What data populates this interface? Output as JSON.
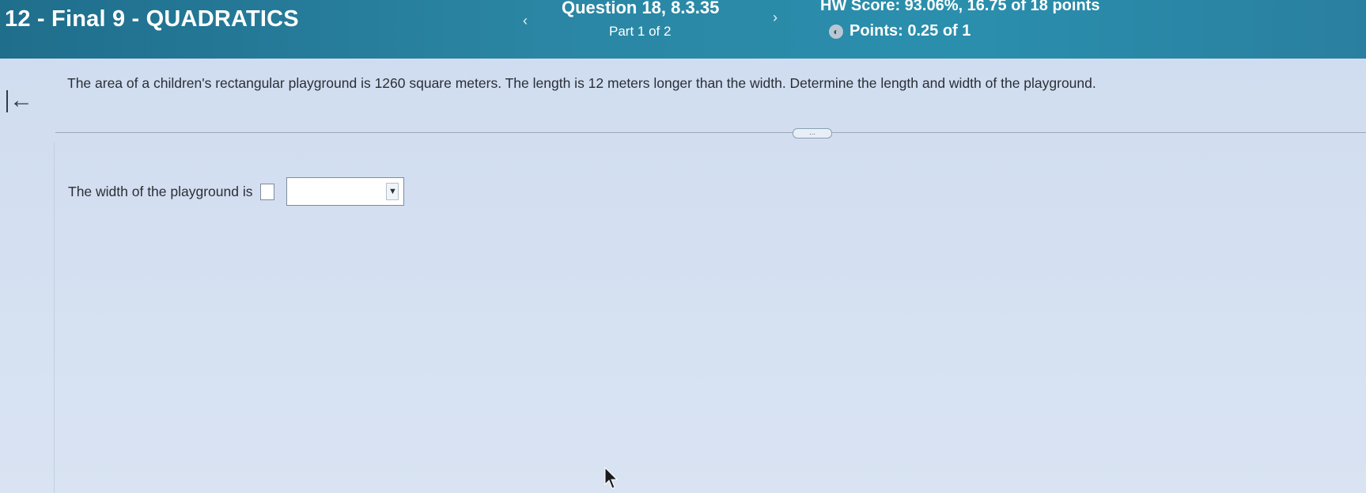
{
  "header": {
    "course_title": "12 - Final 9 - QUADRATICS",
    "question_title": "Question 18, 8.3.35",
    "part_label": "Part 1 of 2",
    "hw_score": "HW Score: 93.06%, 16.75 of 18 points",
    "points": "Points: 0.25 of 1",
    "prev_icon": "chevron-left-icon",
    "next_icon": "chevron-right-icon"
  },
  "question": {
    "text": "The area of a children's rectangular playground is 1260 square meters. The length is 12 meters longer than the width. Determine the length and width of the playground."
  },
  "answer": {
    "label": "The width of the playground is",
    "value": "",
    "unit_selected": ""
  },
  "more_button_label": "...",
  "colors": {
    "header_bg": "#2a86a4",
    "page_bg": "#d4e0f1",
    "text": "#2a2f36"
  }
}
